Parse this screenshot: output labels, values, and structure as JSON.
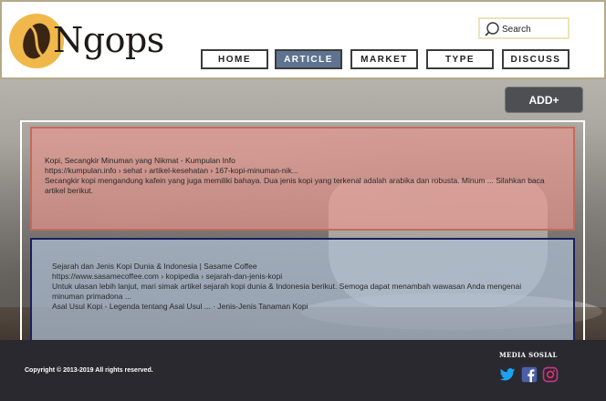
{
  "brand": {
    "name": "Ngops"
  },
  "search": {
    "placeholder": "Search"
  },
  "nav": [
    {
      "label": "HOME",
      "active": false
    },
    {
      "label": "ARTICLE",
      "active": true
    },
    {
      "label": "MARKET",
      "active": false
    },
    {
      "label": "TYPE",
      "active": false
    },
    {
      "label": "DISCUSS",
      "active": false
    }
  ],
  "actions": {
    "add_label": "ADD+"
  },
  "articles": [
    {
      "title": "Kopi, Secangkir Minuman yang Nikmat - Kumpulan Info",
      "url": "https://kumpulan.info › sehat › artikel-kesehatan › 167-kopi-minuman-nik...",
      "snippet": "Secangkir kopi mengandung kafein yang juga memiliki bahaya. Dua jenis kopi yang terkenal adalah arabika dan robusta. Minum ... Silahkan baca artikel berikut."
    },
    {
      "title": "Sejarah dan Jenis Kopi Dunia & Indonesia | Sasame Coffee",
      "url": "https://www.sasamecoffee.com › kopipedia › sejarah-dan-jenis-kopi",
      "snippet": "Untuk ulasan lebih lanjut, mari simak artikel sejarah kopi dunia & Indonesia berikut. Semoga dapat menambah wawasan Anda mengenai minuman primadona ...",
      "links": "Asal Usul Kopi - Legenda tentang Asal Usul ... · Jenis-Jenis Tanaman Kopi"
    }
  ],
  "footer": {
    "copyright": "Copyright © 2013-2019  All rights reserved.",
    "social_heading": "MEDIA SOSIAL",
    "social_icons": [
      "twitter-icon",
      "facebook-icon",
      "instagram-icon"
    ]
  },
  "colors": {
    "header_border": "#b3a98a",
    "nav_active": "#5e7390",
    "card_1_bg": "#ee968c",
    "card_1_border": "#c26b5e",
    "card_2_bg": "#b0c0d6",
    "card_2_border": "#1d1d5e",
    "footer_bg": "#2a2930",
    "twitter": "#1da1f2",
    "facebook": "#3b5998",
    "instagram": "#c13584"
  }
}
